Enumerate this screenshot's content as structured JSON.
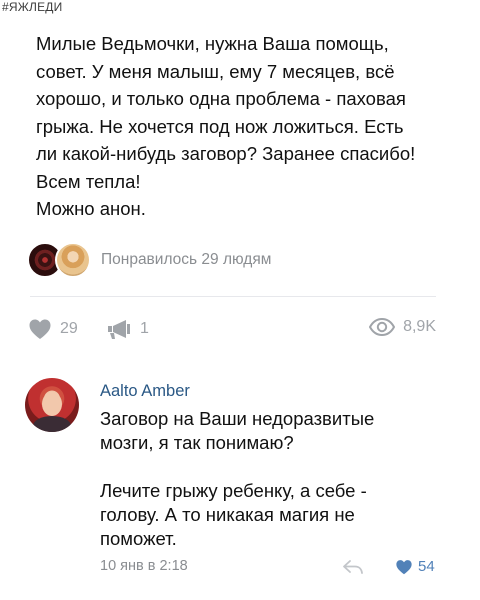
{
  "hashtag": "#ЯЖЛЕДИ",
  "post": {
    "lines": [
      "Милые Ведьмочки, нужна Ваша помощь,",
      "совет. У меня малыш, ему 7 месяцев, всё",
      "хорошо, и только одна проблема - паховая",
      "грыжа. Не хочется под нож ложиться. Есть",
      "ли какой-нибудь заговор? Заранее спасибо!",
      "Всем тепла!",
      "Можно анон."
    ]
  },
  "likers": {
    "label": "Понравилось 29 людям"
  },
  "actions": {
    "likes": "29",
    "shares": "1",
    "views": "8,9K"
  },
  "comment": {
    "author": "Aalto Amber",
    "lines_1": [
      "Заговор на Ваши недоразвитые",
      "мозги, я так понимаю?"
    ],
    "lines_2": [
      "Лечите грыжу ребенку, а себе -",
      "голову. А то никакая магия не",
      "поможет."
    ],
    "date": "10 янв в 2:18",
    "likes": "54"
  },
  "colors": {
    "link": "#2a5885",
    "muted": "#8a8d91",
    "icon": "#a0a4a9",
    "liked": "#5181b8"
  }
}
